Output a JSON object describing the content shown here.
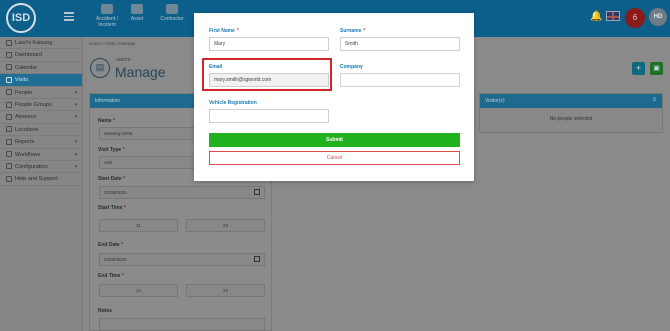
{
  "app": {
    "logo_text": "ISD",
    "nav_tiles": [
      {
        "label": "Accident / Incident",
        "icon": "warning-icon"
      },
      {
        "label": "Asset",
        "icon": "box-icon"
      },
      {
        "label": "Contractor",
        "icon": "hardhat-icon"
      }
    ],
    "alert_count": "6",
    "avatar_initials": "HD"
  },
  "sidebar": {
    "items": [
      {
        "label": "Lauri's Kaisung",
        "icon": "chevron-icon",
        "active": false
      },
      {
        "label": "Dashboard",
        "icon": "dashboard-icon",
        "active": false
      },
      {
        "label": "Calendar",
        "icon": "calendar-icon",
        "active": false
      },
      {
        "label": "Visits",
        "icon": "visits-icon",
        "active": true
      },
      {
        "label": "People",
        "icon": "person-icon",
        "active": false,
        "chevron": true
      },
      {
        "label": "People Groups",
        "icon": "group-icon",
        "active": false,
        "chevron": true
      },
      {
        "label": "Absence",
        "icon": "absence-icon",
        "active": false,
        "chevron": true
      },
      {
        "label": "Locations",
        "icon": "pin-icon",
        "active": false
      },
      {
        "label": "Reports",
        "icon": "report-icon",
        "active": false,
        "chevron": true
      },
      {
        "label": "Workflows",
        "icon": "workflow-icon",
        "active": false,
        "chevron": true
      },
      {
        "label": "Configuration",
        "icon": "gear-icon",
        "active": false,
        "chevron": true
      },
      {
        "label": "Help and Support",
        "icon": "help-icon",
        "active": false
      }
    ]
  },
  "breadcrumb": "Home / Visits / Manage",
  "page": {
    "kicker": "VISITS",
    "title": "Manage"
  },
  "info_panel": {
    "header": "Information",
    "name_label": "Name",
    "name_value": "Meeting 02/05",
    "visit_type_label": "Visit Type",
    "visit_type_value": "Visit",
    "start_date_label": "Start Date",
    "start_date_value": "02/05/2025",
    "start_time_label": "Start Time",
    "start_hour": "11",
    "start_minute": "23",
    "end_date_label": "End Date",
    "end_date_value": "02/05/2025",
    "end_time_label": "End Time",
    "end_hour": "12",
    "end_minute": "23",
    "notes_label": "Notes"
  },
  "visitors_panel": {
    "header": "Visitor(s)",
    "empty_text": "No people selected"
  },
  "modal": {
    "first_name_label": "First Name",
    "first_name_value": "Mary",
    "surname_label": "Surname",
    "surname_value": "Smith",
    "email_label": "Email",
    "email_value": "mary.smith@sgworld.com",
    "company_label": "Company",
    "company_value": "",
    "vehicle_label": "Vehicle Registration",
    "vehicle_value": "",
    "submit_label": "Submit",
    "cancel_label": "Cancel",
    "required_mark": "*"
  },
  "colors": {
    "accent": "#1a7ab3",
    "submit": "#22b11f",
    "danger": "#d0262b",
    "topbar": "#0b5f8a"
  }
}
